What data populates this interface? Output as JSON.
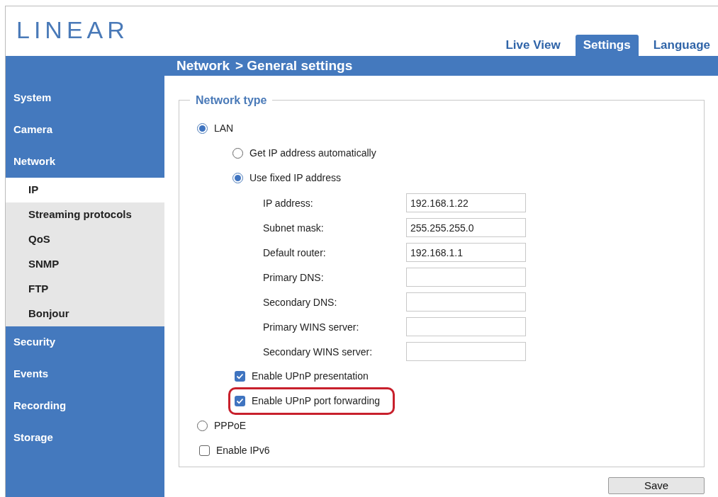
{
  "header": {
    "logo": "LINEAR",
    "tabs": [
      {
        "label": "Live View",
        "selected": false
      },
      {
        "label": "Settings",
        "selected": true
      },
      {
        "label": "Language",
        "selected": false
      }
    ]
  },
  "breadcrumb": [
    "Network",
    "> General settings"
  ],
  "sidebar": {
    "items": [
      {
        "label": "System"
      },
      {
        "label": "Camera"
      },
      {
        "label": "Network",
        "children": [
          {
            "label": "IP",
            "selected": true
          },
          {
            "label": "Streaming protocols",
            "selected": false
          },
          {
            "label": "QoS",
            "selected": false
          },
          {
            "label": "SNMP",
            "selected": false
          },
          {
            "label": "FTP",
            "selected": false
          },
          {
            "label": "Bonjour",
            "selected": false
          }
        ]
      },
      {
        "label": "Security"
      },
      {
        "label": "Events"
      },
      {
        "label": "Recording"
      },
      {
        "label": "Storage"
      }
    ]
  },
  "form": {
    "legend": "Network type",
    "options": [
      {
        "kind": "radio",
        "label": "LAN",
        "selected": true,
        "children": [
          {
            "kind": "radio",
            "label": "Get IP address automatically",
            "selected": false
          },
          {
            "kind": "radio",
            "label": "Use fixed IP address",
            "selected": true,
            "children": [
              {
                "kind": "field",
                "label": "IP address:",
                "value": "192.168.1.22"
              },
              {
                "kind": "field",
                "label": "Subnet mask:",
                "value": "255.255.255.0"
              },
              {
                "kind": "field",
                "label": "Default router:",
                "value": "192.168.1.1"
              },
              {
                "kind": "field",
                "label": "Primary DNS:"
              },
              {
                "kind": "field",
                "label": "Secondary DNS:"
              },
              {
                "kind": "field",
                "label": "Primary WINS server:"
              },
              {
                "kind": "field",
                "label": "Secondary WINS server:"
              }
            ]
          },
          {
            "kind": "checkbox",
            "label": "Enable UPnP presentation",
            "checked": true,
            "highlighted": false
          },
          {
            "kind": "checkbox",
            "label": "Enable UPnP port forwarding",
            "checked": true,
            "highlighted": true
          }
        ]
      },
      {
        "kind": "radio",
        "label": "PPPoE",
        "selected": false
      },
      {
        "kind": "checkbox",
        "label": "Enable IPv6",
        "checked": false,
        "highlighted": false
      }
    ],
    "save": "Save"
  }
}
